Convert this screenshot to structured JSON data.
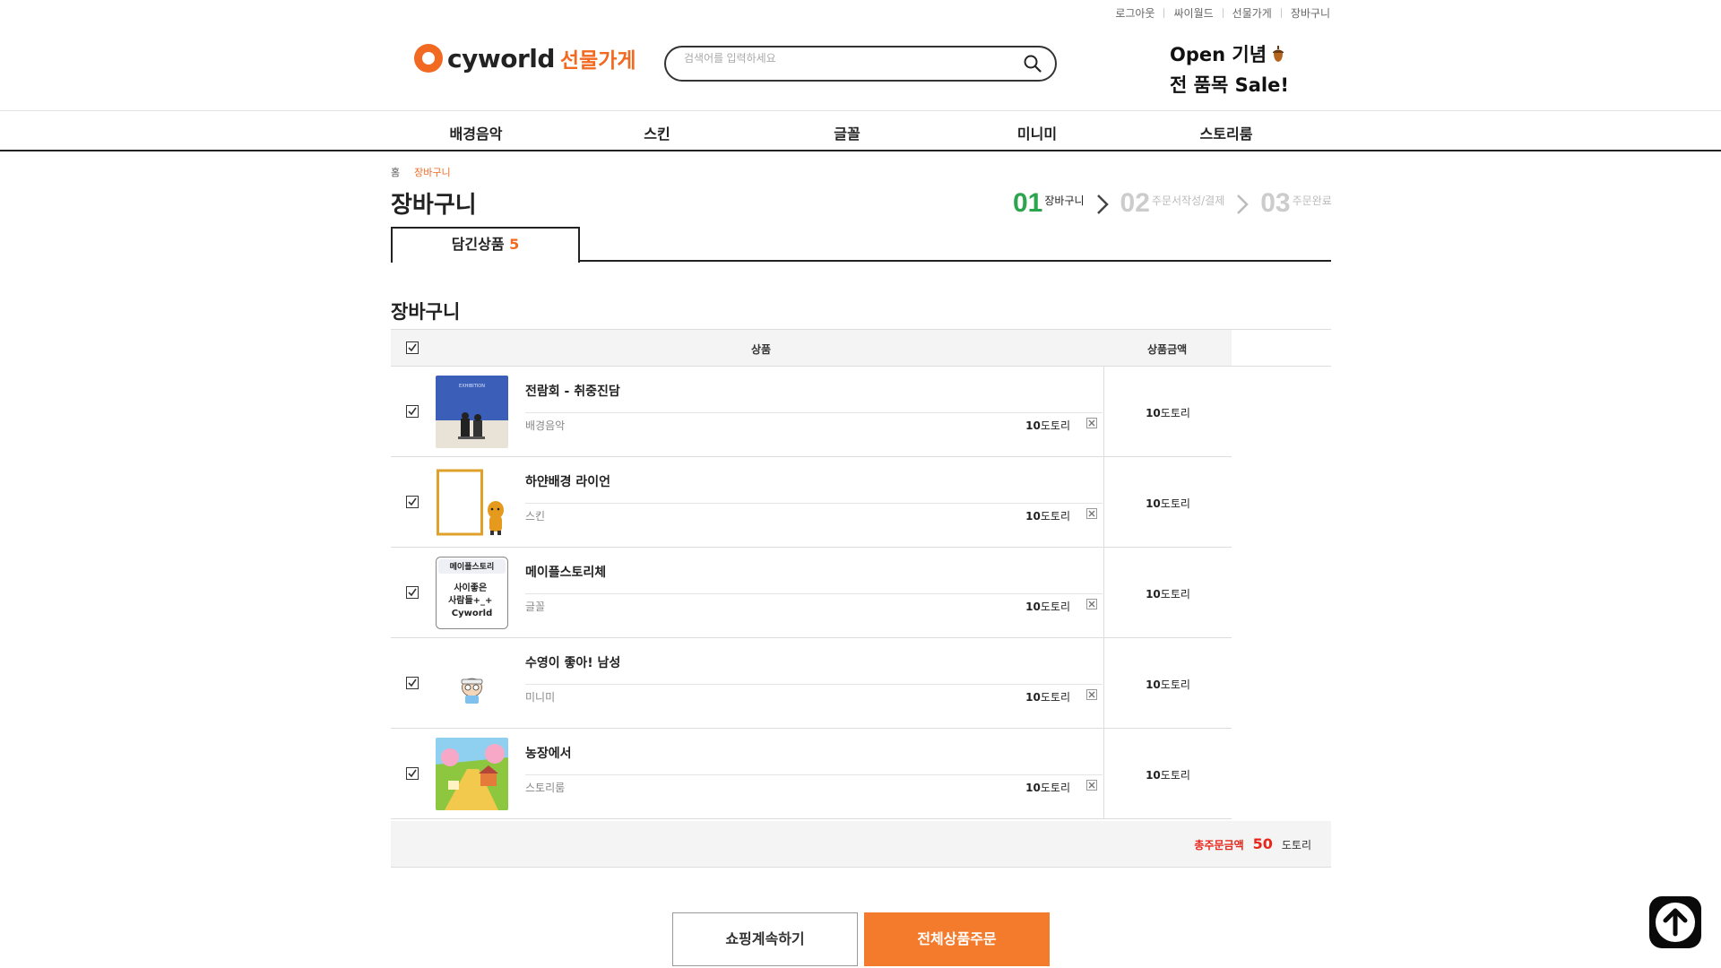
{
  "util_links": [
    "로그아웃",
    "싸이월드",
    "선물가게",
    "장바구니"
  ],
  "logo": {
    "word": "cyworld",
    "sub": "선물가게"
  },
  "search": {
    "placeholder": "검색어를 입력하세요"
  },
  "promo": {
    "line1": "Open 기념",
    "line2": "전 품목 Sale!"
  },
  "nav": [
    "배경음악",
    "스킨",
    "글꼴",
    "미니미",
    "스토리룸"
  ],
  "breadcrumb": {
    "home": "홈",
    "current": "장바구니"
  },
  "page_title": "장바구니",
  "steps": [
    {
      "num": "01",
      "label": "장바구니"
    },
    {
      "num": "02",
      "label": "주문서작성/결제"
    },
    {
      "num": "03",
      "label": "주문완료"
    }
  ],
  "tab": {
    "label": "담긴상품",
    "count": "5"
  },
  "section_title": "장바구니",
  "table_headers": {
    "product": "상품",
    "amount": "상품금액"
  },
  "items": [
    {
      "name": "전람회 - 취중진담",
      "category": "배경음악",
      "price_num": "10",
      "price_unit": "도토리",
      "total_num": "10",
      "total_unit": "도토리"
    },
    {
      "name": "하얀배경 라이언",
      "category": "스킨",
      "price_num": "10",
      "price_unit": "도토리",
      "total_num": "10",
      "total_unit": "도토리"
    },
    {
      "name": "메이플스토리체",
      "category": "글꼴",
      "price_num": "10",
      "price_unit": "도토리",
      "total_num": "10",
      "total_unit": "도토리"
    },
    {
      "name": "수영이 좋아! 남성",
      "category": "미니미",
      "price_num": "10",
      "price_unit": "도토리",
      "total_num": "10",
      "total_unit": "도토리"
    },
    {
      "name": "농장에서",
      "category": "스토리룸",
      "price_num": "10",
      "price_unit": "도토리",
      "total_num": "10",
      "total_unit": "도토리"
    }
  ],
  "thumb_texts": {
    "exhibition": "EXHIBITION",
    "font_name": "메이플스토리",
    "font_sample": "사이좋은\n사람들+_+\nCyworld"
  },
  "summary": {
    "label": "총주문금액",
    "amount": "50",
    "unit": "도토리"
  },
  "buttons": {
    "continue": "쇼핑계속하기",
    "order": "전체상품주문"
  },
  "colors": {
    "accent": "#f26a21",
    "order_btn": "#f47b2c",
    "step_active": "#2da44e",
    "total_red": "#e8261b"
  }
}
